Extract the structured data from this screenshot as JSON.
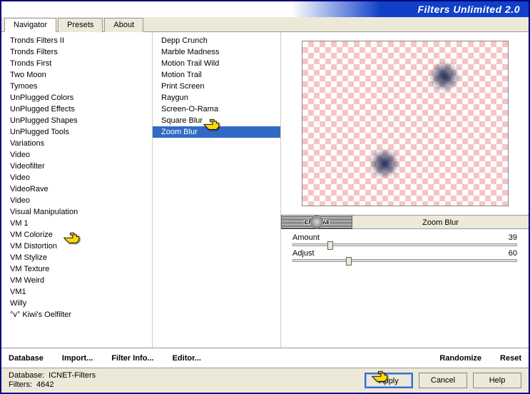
{
  "title": "Filters Unlimited 2.0",
  "tabs": [
    "Navigator",
    "Presets",
    "About"
  ],
  "activeTab": 0,
  "categories": [
    "Tronds Filters II",
    "Tronds Filters",
    "Tronds First",
    "Two Moon",
    "Tymoes",
    "UnPlugged Colors",
    "UnPlugged Effects",
    "UnPlugged Shapes",
    "UnPlugged Tools",
    "Variations",
    "Video",
    "Videofilter",
    "Video",
    "VideoRave",
    "Video",
    "Visual Manipulation",
    "VM 1",
    "VM Colorize",
    "VM Distortion",
    "VM Stylize",
    "VM Texture",
    "VM Weird",
    "VM1",
    "Willy",
    "°v° Kiwi's Oelfilter"
  ],
  "filters": [
    "Depp Crunch",
    "Marble Madness",
    "Motion Trail Wild",
    "Motion Trail",
    "Print Screen",
    "Raygun",
    "Screen-O-Rama",
    "Square Blur",
    "Zoom Blur"
  ],
  "selectedFilter": "Zoom Blur",
  "watermark": "claudia",
  "params": [
    {
      "label": "Amount",
      "value": 39
    },
    {
      "label": "Adjust",
      "value": 60
    }
  ],
  "bottomButtons": {
    "database": "Database",
    "import": "Import...",
    "filterInfo": "Filter Info...",
    "editor": "Editor...",
    "randomize": "Randomize",
    "reset": "Reset"
  },
  "status": {
    "dbLabel": "Database:",
    "dbValue": "ICNET-Filters",
    "filtersLabel": "Filters:",
    "filtersValue": "4642"
  },
  "winButtons": {
    "apply": "Apply",
    "cancel": "Cancel",
    "help": "Help"
  }
}
